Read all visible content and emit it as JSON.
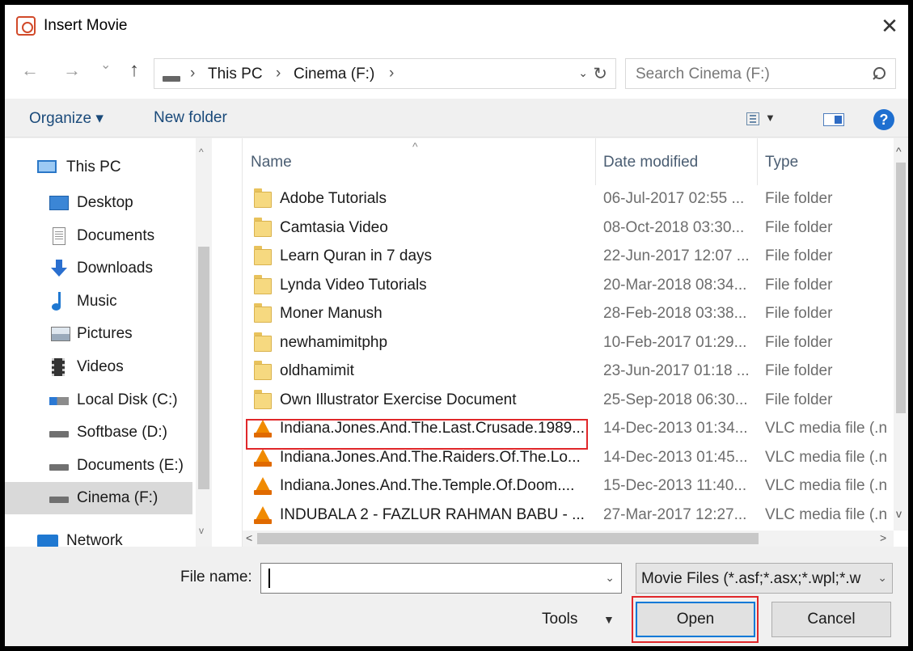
{
  "window": {
    "title": "Insert Movie",
    "close_glyph": "✕"
  },
  "nav_buttons": {
    "back": "←",
    "forward": "→",
    "recent": "⌄",
    "up": "↑"
  },
  "address": {
    "crumbs": [
      "This PC",
      "Cinema (F:)"
    ],
    "separator": "›",
    "dropdown_glyph": "⌄",
    "refresh_glyph": "↻"
  },
  "search": {
    "placeholder": "Search Cinema (F:)"
  },
  "toolbar": {
    "organize": "Organize ▾",
    "new_folder": "New folder",
    "view_dd": "▼",
    "help": "?"
  },
  "nav_pane": {
    "items": [
      {
        "label": "This PC",
        "icon": "monitor-icon"
      },
      {
        "label": "Desktop",
        "icon": "desktop-icon"
      },
      {
        "label": "Documents",
        "icon": "documents-icon"
      },
      {
        "label": "Downloads",
        "icon": "downloads-icon"
      },
      {
        "label": "Music",
        "icon": "music-icon"
      },
      {
        "label": "Pictures",
        "icon": "pictures-icon"
      },
      {
        "label": "Videos",
        "icon": "videos-icon"
      },
      {
        "label": "Local Disk (C:)",
        "icon": "local-disk-icon"
      },
      {
        "label": "Softbase (D:)",
        "icon": "drive-icon"
      },
      {
        "label": "Documents (E:)",
        "icon": "drive-icon"
      },
      {
        "label": "Cinema (F:)",
        "icon": "drive-icon",
        "selected": true
      },
      {
        "label": "Network",
        "icon": "network-icon"
      }
    ],
    "scroll_up": "^",
    "scroll_down": "v"
  },
  "file_list": {
    "columns": {
      "name": "Name",
      "date": "Date modified",
      "type": "Type"
    },
    "sort_glyph": "^",
    "rows": [
      {
        "name": "Adobe Tutorials",
        "date": "06-Jul-2017 02:55 ...",
        "type": "File folder",
        "kind": "folder"
      },
      {
        "name": "Camtasia Video",
        "date": "08-Oct-2018 03:30...",
        "type": "File folder",
        "kind": "folder"
      },
      {
        "name": "Learn Quran in 7 days",
        "date": "22-Jun-2017 12:07 ...",
        "type": "File folder",
        "kind": "folder"
      },
      {
        "name": "Lynda Video Tutorials",
        "date": "20-Mar-2018 08:34...",
        "type": "File folder",
        "kind": "folder"
      },
      {
        "name": "Moner Manush",
        "date": "28-Feb-2018 03:38...",
        "type": "File folder",
        "kind": "folder"
      },
      {
        "name": "newhamimitphp",
        "date": "10-Feb-2017 01:29...",
        "type": "File folder",
        "kind": "folder"
      },
      {
        "name": "oldhamimit",
        "date": "23-Jun-2017 01:18 ...",
        "type": "File folder",
        "kind": "folder"
      },
      {
        "name": "Own Illustrator Exercise Document",
        "date": "25-Sep-2018 06:30...",
        "type": "File folder",
        "kind": "folder"
      },
      {
        "name": "Indiana.Jones.And.The.Last.Crusade.1989...",
        "date": "14-Dec-2013 01:34...",
        "type": "VLC media file (.n",
        "kind": "vlc",
        "highlighted": true
      },
      {
        "name": "Indiana.Jones.And.The.Raiders.Of.The.Lo...",
        "date": "14-Dec-2013 01:45...",
        "type": "VLC media file (.n",
        "kind": "vlc"
      },
      {
        "name": "Indiana.Jones.And.The.Temple.Of.Doom....",
        "date": "15-Dec-2013 11:40...",
        "type": "VLC media file (.n",
        "kind": "vlc"
      },
      {
        "name": "INDUBALA 2 - FAZLUR RAHMAN BABU - ...",
        "date": "27-Mar-2017 12:27...",
        "type": "VLC media file (.n",
        "kind": "vlc"
      }
    ],
    "scroll_up": "^",
    "scroll_down": "v",
    "scroll_left": "<",
    "scroll_right": ">"
  },
  "bottom": {
    "file_name_label": "File name:",
    "file_name_value": "",
    "dropdown_glyph": "⌄",
    "filter": "Movie Files (*.asf;*.asx;*.wpl;*.w",
    "tools": "Tools",
    "tools_dd": "▼",
    "open": "Open",
    "cancel": "Cancel"
  },
  "colors": {
    "highlight": "#e0272a",
    "accent": "#0078d7"
  }
}
